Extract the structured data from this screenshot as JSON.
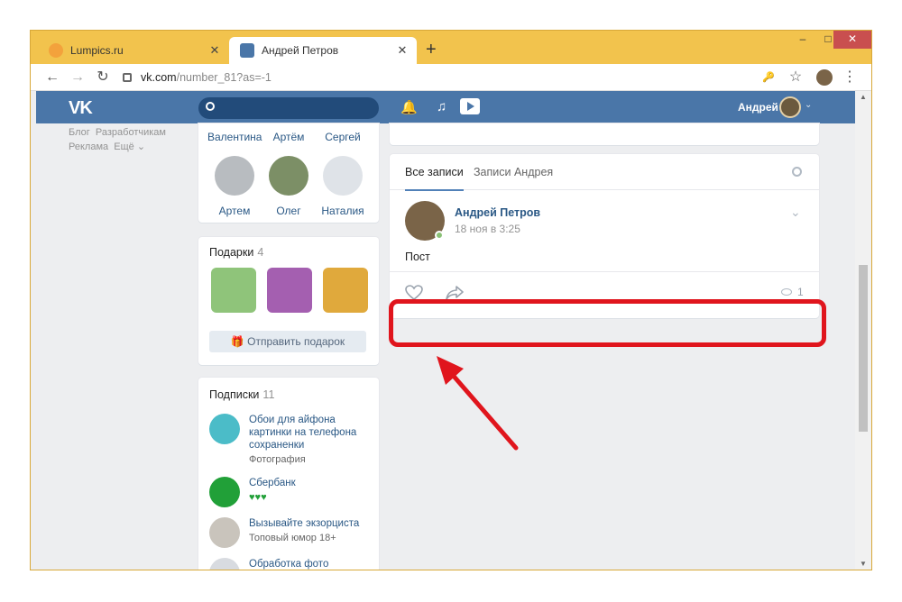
{
  "browser": {
    "tabs": [
      {
        "title": "Lumpics.ru",
        "close": "✕",
        "favicon_color": "#f3a23c"
      },
      {
        "title": "Андрей Петров",
        "close": "✕",
        "favicon_color": "#4a76a8"
      }
    ],
    "new_tab": "+",
    "window_controls": [
      "–",
      "□",
      "✕"
    ],
    "address": {
      "host": "vk.com",
      "path": "/number_81?as=-1"
    },
    "nav": {
      "back": "←",
      "forward": "→",
      "reload": "↻"
    },
    "toolbar_icons": {
      "key": "🔑",
      "star": "☆",
      "menu": "⋮"
    }
  },
  "vk": {
    "logo": "VK",
    "header_user": "Андрей",
    "left_menu": {
      "line1": [
        "Блог",
        "Разработчикам"
      ],
      "line2": [
        "Реклама",
        "Ещё"
      ]
    },
    "friends_top_row": [
      "Валентина",
      "Артём",
      "Сергей"
    ],
    "friends_bottom_row": [
      {
        "name": "Артем",
        "color": "#b8bcc0"
      },
      {
        "name": "Олег",
        "color": "#7c8f66"
      },
      {
        "name": "Наталия",
        "color": "#dfe3e8"
      }
    ],
    "gifts": {
      "title": "Подарки",
      "count": "4",
      "send_label": "Отправить подарок"
    },
    "subscriptions": {
      "title": "Подписки",
      "count": "11",
      "items": [
        {
          "name_lines": [
            "Обои для айфона",
            "картинки на телефона",
            "сохраненки"
          ],
          "desc": "Фотография",
          "color": "#4bbcc8"
        },
        {
          "name_lines": [
            "Сбербанк"
          ],
          "desc": "♥♥♥",
          "color": "#21a038"
        },
        {
          "name_lines": [
            "Вызывайте экзорциста"
          ],
          "desc": "Топовый юмор 18+",
          "color": "#c9c4bc"
        },
        {
          "name_lines": [
            "Обработка фото"
          ],
          "desc": "",
          "color": "#d8dbe0"
        }
      ]
    },
    "wall": {
      "tabs": [
        "Все записи",
        "Записи Андрея"
      ],
      "post": {
        "author": "Андрей Петров",
        "date": "18 ноя в 3:25",
        "text": "Пост",
        "views": "1"
      }
    }
  }
}
